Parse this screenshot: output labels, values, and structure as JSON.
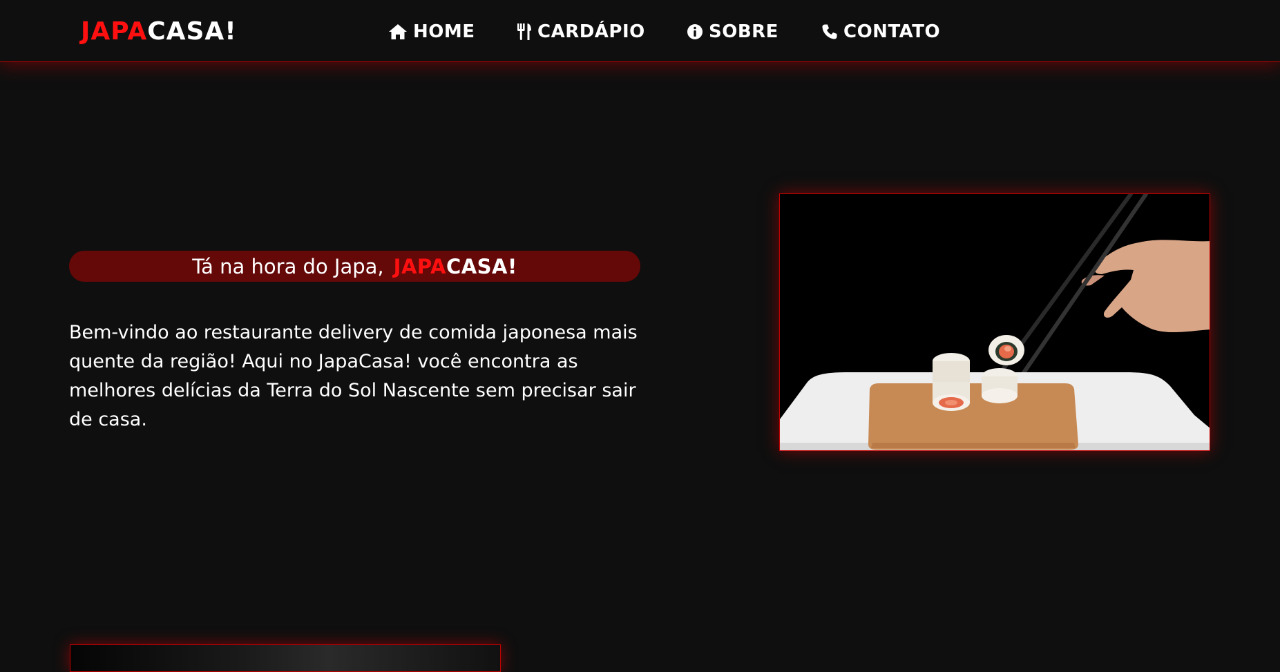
{
  "header": {
    "logo": {
      "part1": "JAPA",
      "part2": "CASA!"
    },
    "nav": [
      {
        "label": "HOME",
        "icon": "home-icon"
      },
      {
        "label": "CARDÁPIO",
        "icon": "utensils-icon"
      },
      {
        "label": "SOBRE",
        "icon": "info-icon"
      },
      {
        "label": "CONTATO",
        "icon": "phone-icon"
      }
    ]
  },
  "hero": {
    "tagline": "Tá na hora do Japa,",
    "brand": {
      "part1": "JAPA",
      "part2": "CASA!"
    },
    "description": "Bem-vindo ao restaurante delivery de comida japonesa mais quente da região! Aqui no JapaCasa! você encontra as melhores delícias da Terra do Sol Nascente sem precisar sair de casa."
  },
  "colors": {
    "background": "#0f0f0f",
    "accent": "#ff1010",
    "title_bar": "#640808",
    "border": "#c40000"
  }
}
